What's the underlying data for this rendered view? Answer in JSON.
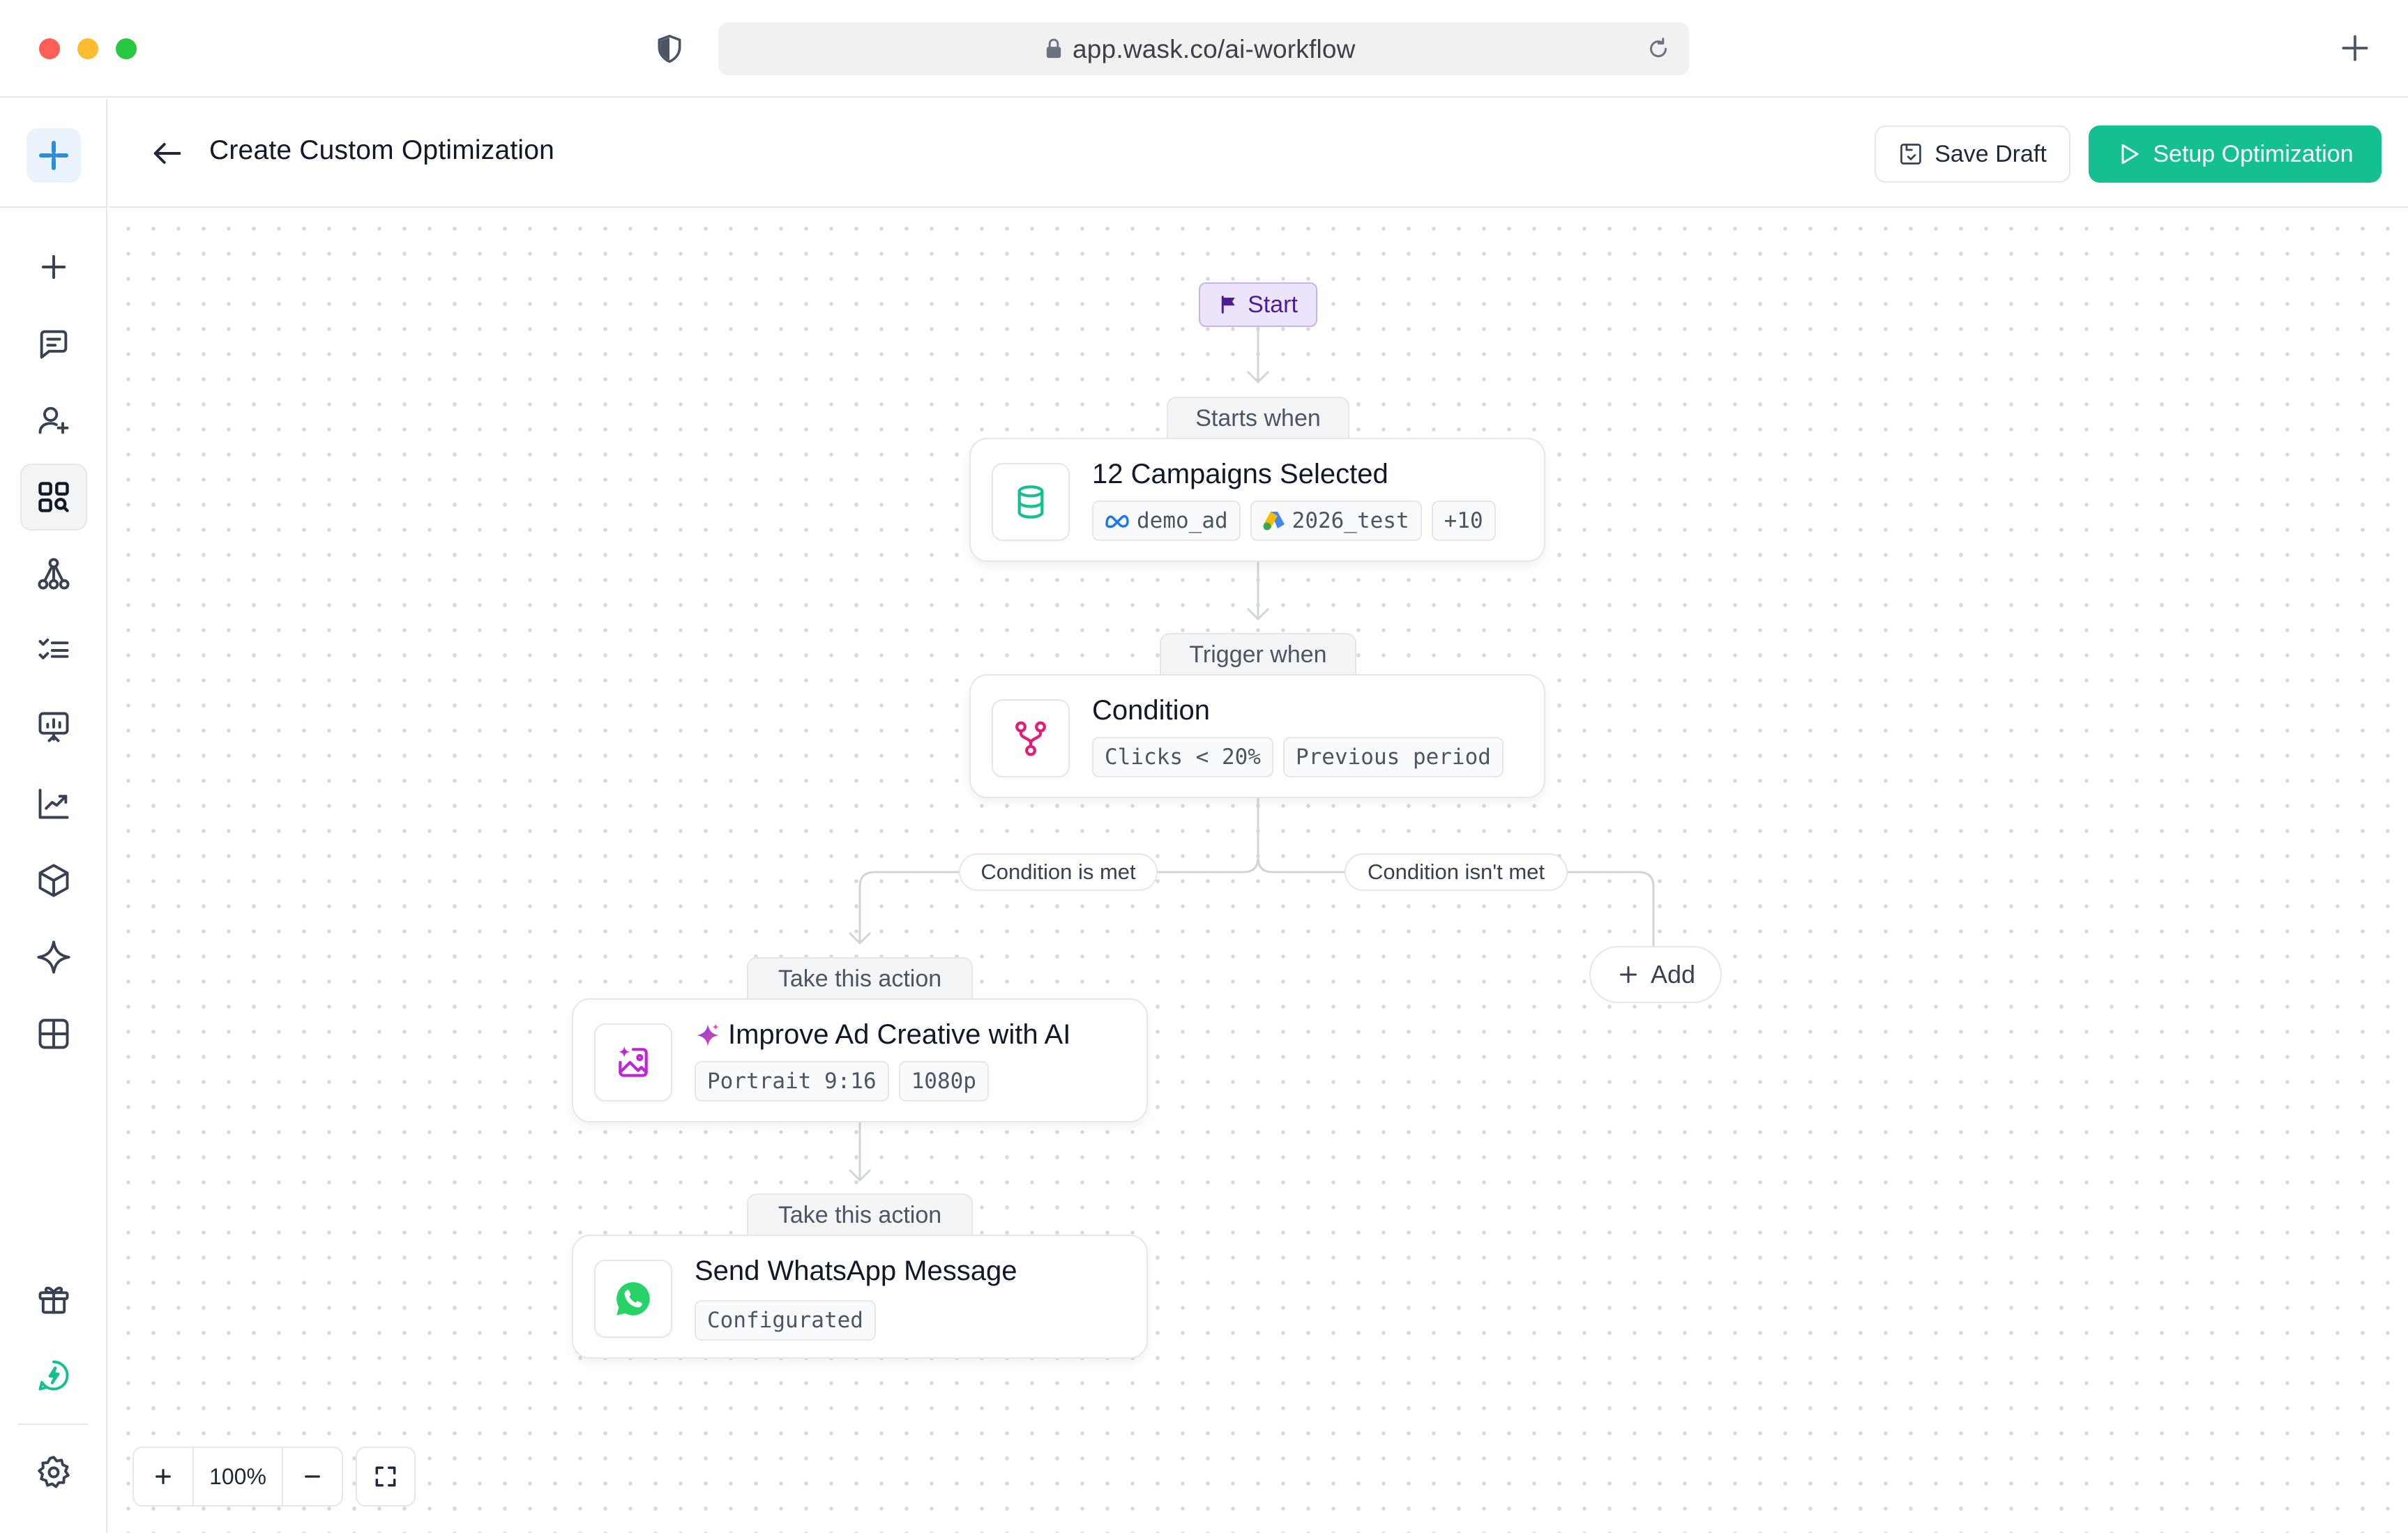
{
  "browser": {
    "url": "app.wask.co/ai-workflow"
  },
  "sidebar": {
    "items": [
      {
        "name": "plus-icon",
        "active": false
      },
      {
        "name": "message-square-icon",
        "active": false
      },
      {
        "name": "user-plus-icon",
        "active": false
      },
      {
        "name": "grid-search-icon",
        "active": true
      },
      {
        "name": "workflow-icon",
        "active": false
      },
      {
        "name": "checklist-icon",
        "active": false
      },
      {
        "name": "presentation-chart-icon",
        "active": false
      },
      {
        "name": "trend-chart-icon",
        "active": false
      },
      {
        "name": "box-icon",
        "active": false
      },
      {
        "name": "sparkle-icon",
        "active": false
      },
      {
        "name": "layout-grid-icon",
        "active": false
      },
      {
        "name": "gift-icon",
        "active": false
      },
      {
        "name": "lightning-chat-icon",
        "active": false
      },
      {
        "name": "settings-icon",
        "active": false
      }
    ],
    "accent": "#14c08f"
  },
  "header": {
    "title": "Create Custom Optimization",
    "save_draft_label": "Save Draft",
    "setup_label": "Setup Optimization"
  },
  "workflow": {
    "start_label": "Start",
    "starts_when_label": "Starts when",
    "campaigns": {
      "title": "12 Campaigns Selected",
      "chips": [
        "demo_ad",
        "2026_test",
        "+10"
      ]
    },
    "trigger_when_label": "Trigger when",
    "condition": {
      "title": "Condition",
      "chips": [
        "Clicks < 20%",
        "Previous period"
      ]
    },
    "condition_met_label": "Condition is met",
    "condition_not_met_label": "Condition isn't met",
    "action_label_1": "Take this action",
    "action_1": {
      "title": "Improve Ad Creative with AI",
      "chips": [
        "Portrait 9:16",
        "1080p"
      ]
    },
    "action_label_2": "Take this action",
    "action_2": {
      "title": "Send WhatsApp Message",
      "chips": [
        "Configurated"
      ]
    },
    "add_label": "Add"
  },
  "zoom": {
    "value": "100%"
  },
  "colors": {
    "primary": "#14c08f",
    "start_bg": "#ebe4fb",
    "start_text": "#4c1d95",
    "whatsapp": "#25d366",
    "ai_accent": "#c026d3"
  }
}
